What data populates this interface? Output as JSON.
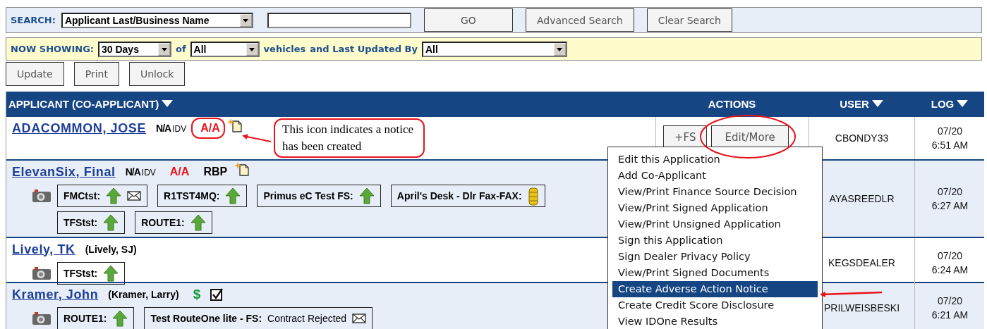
{
  "search": {
    "label": "SEARCH:",
    "field_select": "Applicant Last/Business Name",
    "buttons": [
      "GO",
      "Advanced Search",
      "Clear Search"
    ]
  },
  "filter": {
    "label": "NOW SHOWING:",
    "period": "30 Days",
    "of": "of",
    "vehicles_select": "All",
    "vehicles": "vehicles",
    "updated_by": "and Last Updated By",
    "user_select": "All"
  },
  "toolbar": [
    "Update",
    "Print",
    "Unlock"
  ],
  "table": {
    "columns": [
      {
        "label": "APPLICANT (CO-APPLICANT)",
        "sortable": true
      },
      {
        "label": "ACTIONS",
        "sortable": false
      },
      {
        "label": "USER",
        "sortable": true
      },
      {
        "label": "LOG",
        "sortable": true
      }
    ],
    "rows": [
      {
        "name": "ADACOMMON, JOSE",
        "badges": [
          {
            "kind": "idv",
            "text": "N/A",
            "suffix": "IDV"
          },
          {
            "kind": "aa",
            "text": "A/A",
            "circled": true
          },
          {
            "kind": "notice"
          }
        ],
        "sources": [],
        "actions": [
          "+FS",
          "Edit/More"
        ],
        "user": "CBONDY33",
        "date": "07/20",
        "time": "6:51 AM"
      },
      {
        "name": "ElevanSix, Final",
        "badges": [
          {
            "kind": "idv",
            "text": "N/A",
            "suffix": "IDV"
          },
          {
            "kind": "aa",
            "text": "A/A",
            "circled": false
          },
          {
            "kind": "rbp",
            "text": "RBP"
          },
          {
            "kind": "notice"
          }
        ],
        "sources": [
          {
            "label": "FMCtst:",
            "icons": [
              {
                "kind": "up"
              },
              {
                "kind": "mail"
              }
            ]
          },
          {
            "label": "R1TST4MQ:",
            "icons": [
              {
                "kind": "up"
              }
            ]
          },
          {
            "label": "Primus eC Test FS:",
            "icons": [
              {
                "kind": "up"
              }
            ]
          },
          {
            "label": "April's Desk - Dlr Fax-FAX:",
            "icons": [
              {
                "kind": "coins"
              }
            ]
          },
          {
            "label": "TFStst:",
            "icons": [
              {
                "kind": "up"
              }
            ]
          },
          {
            "label": "ROUTE1:",
            "icons": [
              {
                "kind": "up"
              }
            ]
          }
        ],
        "actions": [],
        "user": "AYASREEDLR",
        "date": "07/20",
        "time": "6:27 AM"
      },
      {
        "name": "Lively, TK",
        "co": "(Lively, SJ)",
        "badges": [],
        "sources": [
          {
            "label": "TFStst:",
            "icons": [
              {
                "kind": "up"
              }
            ]
          }
        ],
        "actions": [],
        "user": "KEGSDEALER",
        "date": "07/20",
        "time": "6:24 AM"
      },
      {
        "name": "Kramer, John",
        "co": "(Kramer, Larry)",
        "badges": [
          {
            "kind": "dollar",
            "text": "$"
          },
          {
            "kind": "checkbox",
            "checked": true
          }
        ],
        "sources": [
          {
            "label": "ROUTE1:",
            "icons": [
              {
                "kind": "up"
              }
            ]
          },
          {
            "label": "Test RouteOne lite - FS:",
            "status": "Contract Rejected",
            "icons": [
              {
                "kind": "mail"
              }
            ]
          }
        ],
        "actions": [],
        "user": "PRILWEISBESKI",
        "date": "07/20",
        "time": "6:21 AM"
      }
    ]
  },
  "menu": [
    {
      "label": "Edit this Application",
      "selected": false
    },
    {
      "label": "Add Co-Applicant",
      "selected": false
    },
    {
      "label": "View/Print Finance Source Decision",
      "selected": false
    },
    {
      "label": "View/Print Signed Application",
      "selected": false
    },
    {
      "label": "View/Print Unsigned Application",
      "selected": false
    },
    {
      "label": "Sign this Application",
      "selected": false
    },
    {
      "label": "Sign Dealer Privacy Policy",
      "selected": false
    },
    {
      "label": "View/Print Signed Documents",
      "selected": false
    },
    {
      "label": "Create Adverse Action Notice",
      "selected": true
    },
    {
      "label": "Create Credit Score Disclosure",
      "selected": false
    },
    {
      "label": "View IDOne Results",
      "selected": false
    }
  ],
  "callout": "This icon indicates a notice has been created"
}
